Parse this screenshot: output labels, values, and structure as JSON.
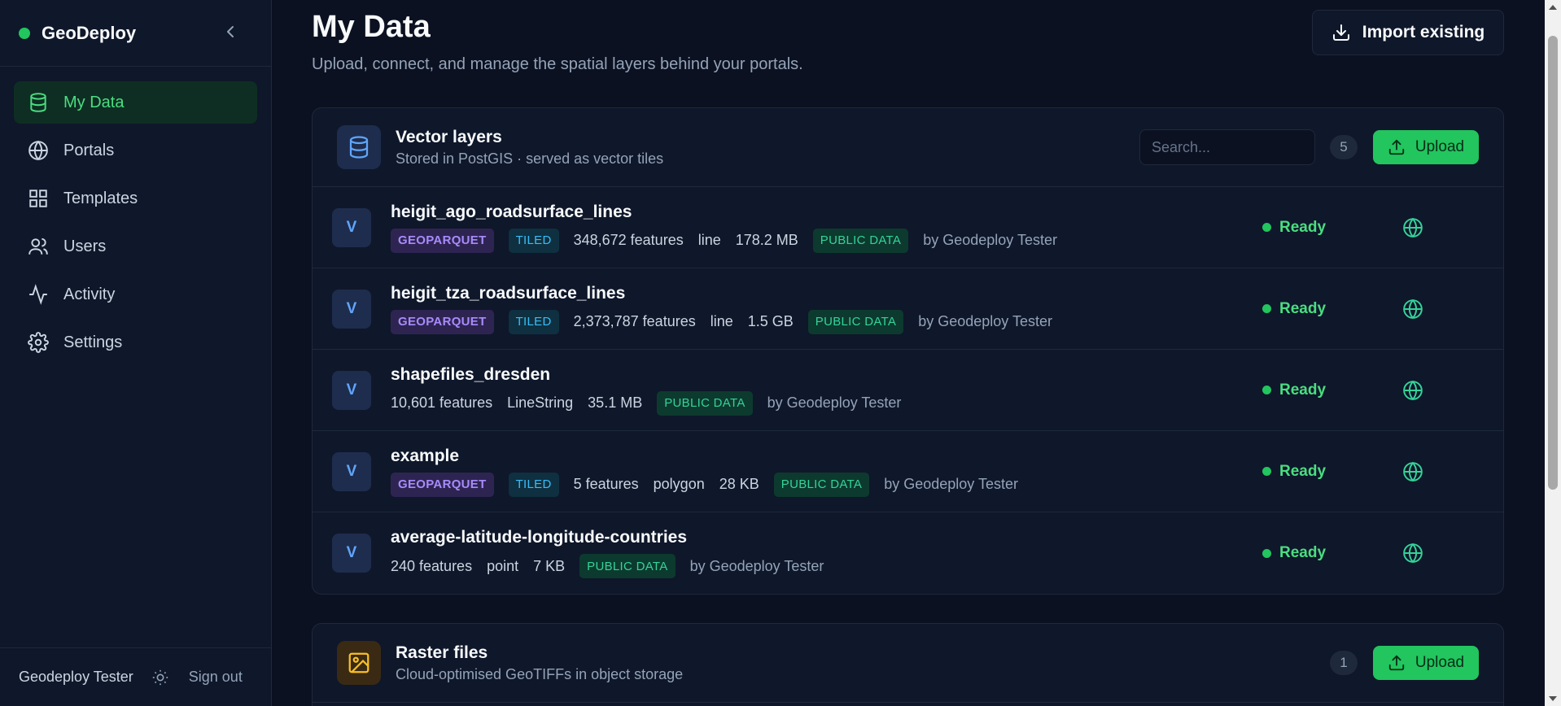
{
  "brand": {
    "name": "GeoDeploy",
    "accent": "#22c55e"
  },
  "sidebar": {
    "items": [
      {
        "label": "My Data",
        "icon": "database-icon",
        "active": true
      },
      {
        "label": "Portals",
        "icon": "globe-icon"
      },
      {
        "label": "Templates",
        "icon": "grid-icon"
      },
      {
        "label": "Users",
        "icon": "users-icon"
      },
      {
        "label": "Activity",
        "icon": "activity-icon"
      },
      {
        "label": "Settings",
        "icon": "gear-icon"
      }
    ],
    "footer": {
      "user": "Geodeploy Tester",
      "sign_out": "Sign out"
    }
  },
  "header": {
    "title": "My Data",
    "subtitle": "Upload, connect, and manage the spatial layers behind your portals.",
    "import_label": "Import existing"
  },
  "vector": {
    "title": "Vector layers",
    "subtitle": "Stored in PostGIS · served as vector tiles",
    "search_placeholder": "Search...",
    "count": "5",
    "upload_label": "Upload",
    "rows": [
      {
        "badge": "V",
        "name": "heigit_ago_roadsurface_lines",
        "format": "GEOPARQUET",
        "tiled": "TILED",
        "features": "348,672 features",
        "geometry": "line",
        "size": "178.2 MB",
        "access": "PUBLIC DATA",
        "owner": "by Geodeploy Tester",
        "status": "Ready"
      },
      {
        "badge": "V",
        "name": "heigit_tza_roadsurface_lines",
        "format": "GEOPARQUET",
        "tiled": "TILED",
        "features": "2,373,787 features",
        "geometry": "line",
        "size": "1.5 GB",
        "access": "PUBLIC DATA",
        "owner": "by Geodeploy Tester",
        "status": "Ready"
      },
      {
        "badge": "V",
        "name": "shapefiles_dresden",
        "format": "",
        "tiled": "",
        "features": "10,601 features",
        "geometry": "LineString",
        "size": "35.1 MB",
        "access": "PUBLIC DATA",
        "owner": "by Geodeploy Tester",
        "status": "Ready"
      },
      {
        "badge": "V",
        "name": "example",
        "format": "GEOPARQUET",
        "tiled": "TILED",
        "features": "5 features",
        "geometry": "polygon",
        "size": "28 KB",
        "access": "PUBLIC DATA",
        "owner": "by Geodeploy Tester",
        "status": "Ready"
      },
      {
        "badge": "V",
        "name": "average-latitude-longitude-countries",
        "format": "",
        "tiled": "",
        "features": "240 features",
        "geometry": "point",
        "size": "7 KB",
        "access": "PUBLIC DATA",
        "owner": "by Geodeploy Tester",
        "status": "Ready"
      }
    ]
  },
  "raster": {
    "title": "Raster files",
    "subtitle": "Cloud-optimised GeoTIFFs in object storage",
    "count": "1",
    "upload_label": "Upload"
  }
}
